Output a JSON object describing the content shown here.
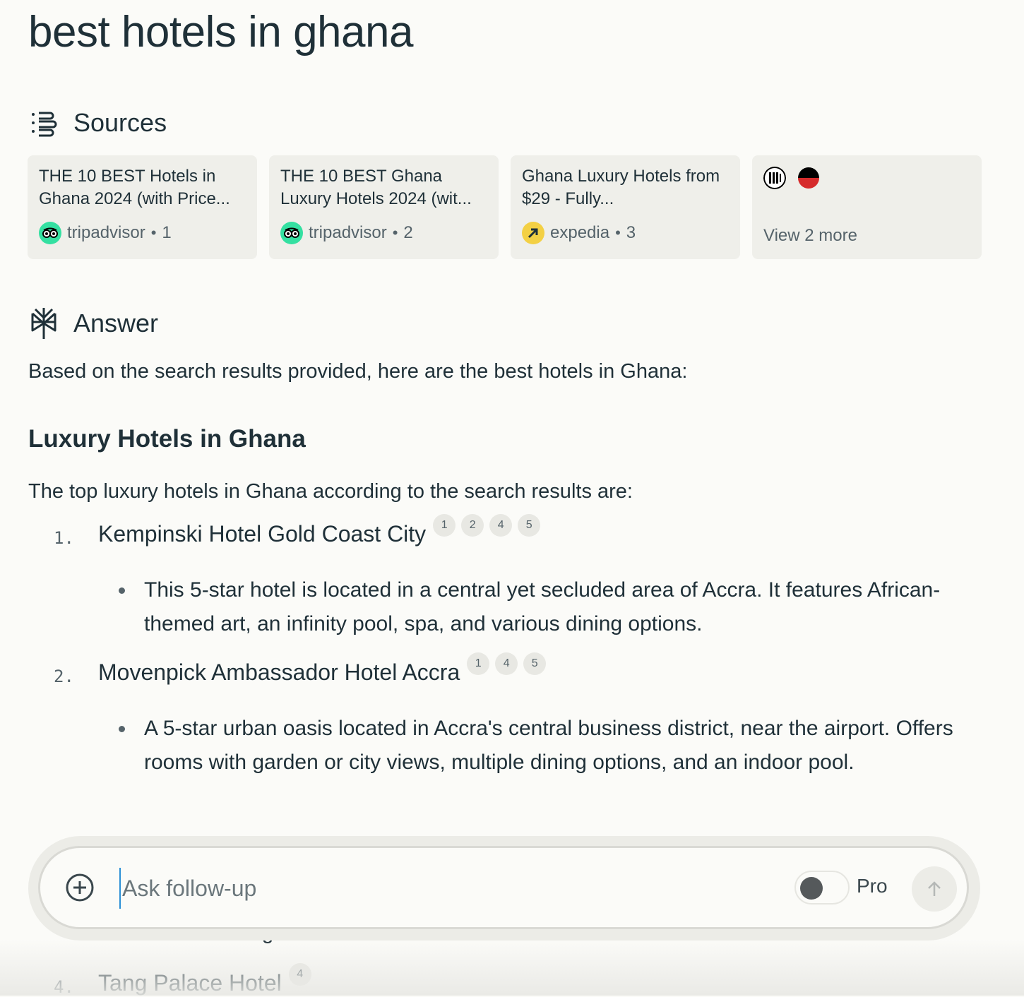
{
  "query": "best hotels in ghana",
  "sources": {
    "heading": "Sources",
    "cards": [
      {
        "title": "THE 10 BEST Hotels in Ghana 2024 (with Price...",
        "site": "tripadvisor",
        "index": "1"
      },
      {
        "title": "THE 10 BEST Ghana Luxury Hotels 2024 (wit...",
        "site": "tripadvisor",
        "index": "2"
      },
      {
        "title": "Ghana Luxury Hotels from $29 - Fully...",
        "site": "expedia",
        "index": "3"
      }
    ],
    "view_more": "View 2 more"
  },
  "answer": {
    "heading": "Answer",
    "intro": "Based on the search results provided, here are the best hotels in Ghana:",
    "subheading": "Luxury Hotels in Ghana",
    "subintro": "The top luxury hotels in Ghana according to the search results are:",
    "items": [
      {
        "number": "1.",
        "name": "Kempinski Hotel Gold Coast City",
        "citations": [
          "1",
          "2",
          "4",
          "5"
        ],
        "detail": "This 5-star hotel is located in a central yet secluded area of Accra. It features African-themed art, an infinity pool, spa, and various dining options."
      },
      {
        "number": "2.",
        "name": "Movenpick Ambassador Hotel Accra",
        "citations": [
          "1",
          "4",
          "5"
        ],
        "detail": "A 5-star urban oasis located in Accra's central business district, near the airport. Offers rooms with garden or city views, multiple dining options, and an indoor pool."
      },
      {
        "number": "4.",
        "name": "Tang Palace Hotel",
        "citations": [
          "4"
        ],
        "detail": ""
      }
    ],
    "partial_text": "Features elegant suites and a fitness room."
  },
  "composer": {
    "placeholder": "Ask follow-up",
    "pro_label": "Pro"
  }
}
